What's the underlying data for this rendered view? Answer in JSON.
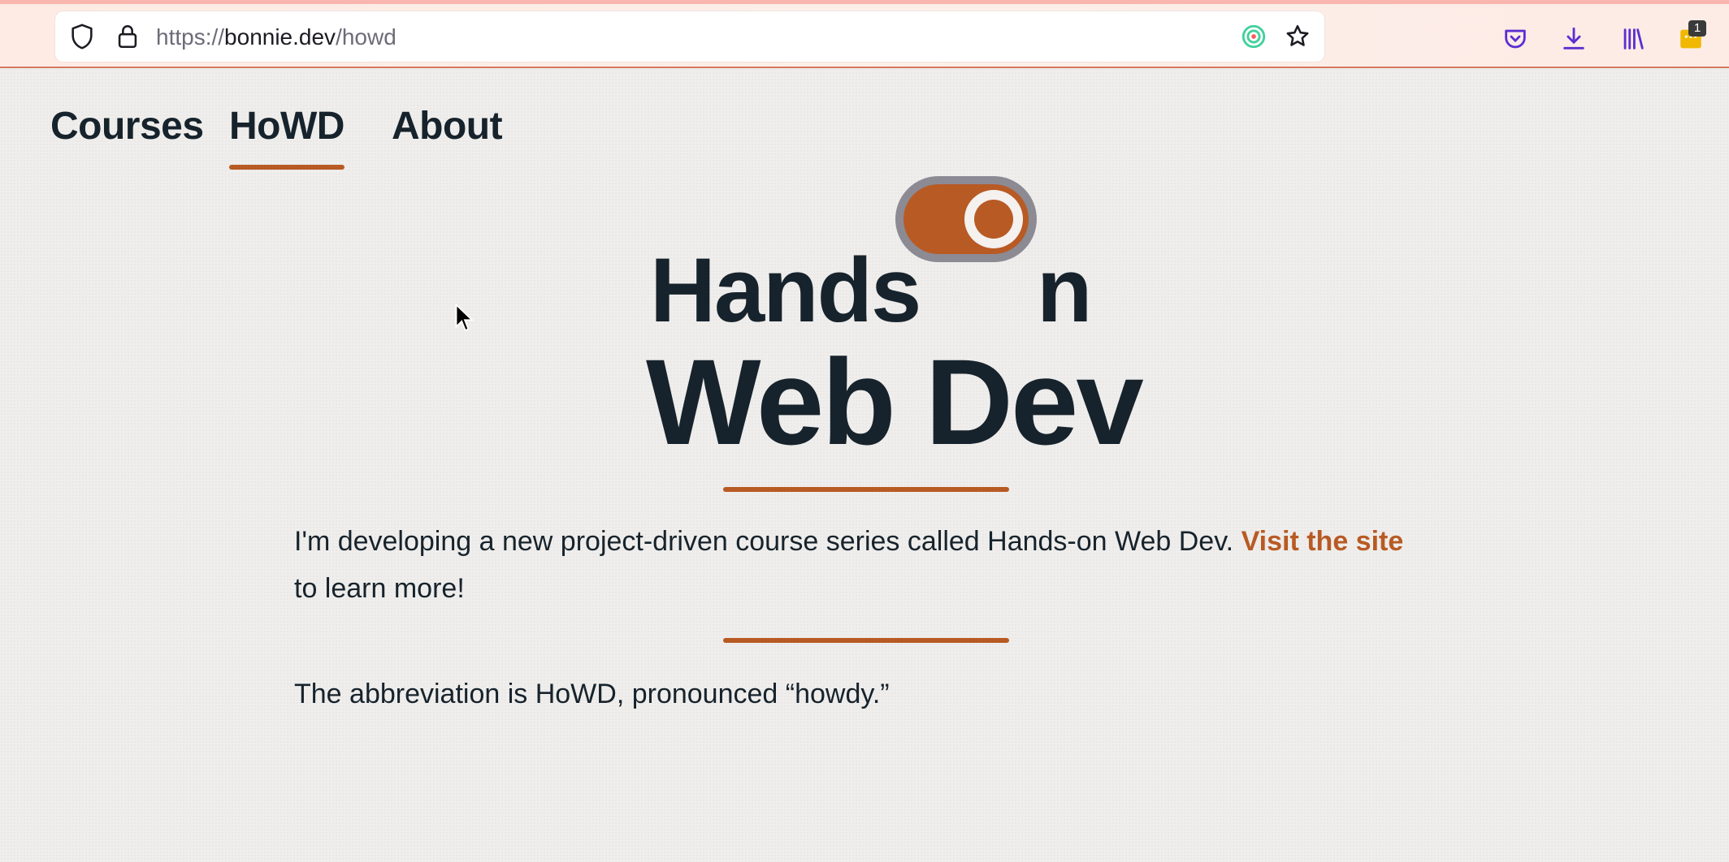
{
  "browser": {
    "url_scheme": "https://",
    "url_domain": "bonnie.dev",
    "url_path": "/howd",
    "extension_badge": "1",
    "icons": [
      "shield-icon",
      "lock-icon",
      "extension-target-icon",
      "bookmark-star-icon",
      "pocket-icon",
      "download-icon",
      "library-icon",
      "extension-icon"
    ]
  },
  "nav": {
    "items": [
      {
        "label": "Courses"
      },
      {
        "label": "HoWD"
      },
      {
        "label": "About"
      }
    ],
    "active": "HoWD"
  },
  "logo": {
    "line1": "Hands",
    "line1_end": "n",
    "line2": "Web Dev"
  },
  "content": {
    "intro_text": "I'm developing a new project-driven course series called Hands-on Web Dev.",
    "intro_link": "Visit the site",
    "intro_text_after": "to learn more!",
    "abbreviation_text": "The abbreviation is HoWD, pronounced “howdy.”"
  },
  "colors": {
    "accent": "#b85a24",
    "text": "#17232c",
    "background": "#efeeec"
  }
}
